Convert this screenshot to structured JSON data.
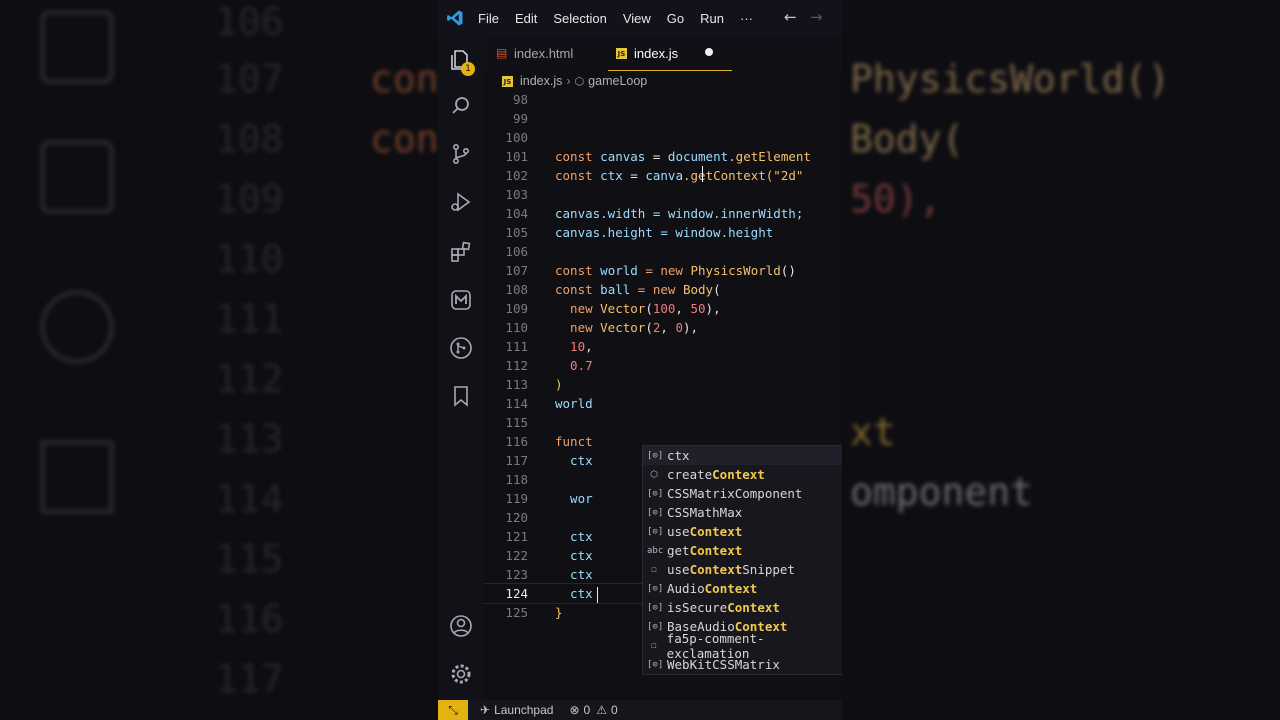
{
  "menubar": {
    "items": [
      "File",
      "Edit",
      "Selection",
      "View",
      "Go",
      "Run",
      "···"
    ]
  },
  "tabs": [
    {
      "label": "index.html",
      "type": "html"
    },
    {
      "label": "index.js",
      "type": "js",
      "modified": true
    }
  ],
  "breadcrumb": {
    "file": "index.js",
    "symbol": "gameLoop"
  },
  "activity_badge": "1",
  "editor": {
    "line_numbers": [
      "98",
      "99",
      "100",
      "101",
      "102",
      "103",
      "104",
      "105",
      "106",
      "107",
      "108",
      "109",
      "110",
      "111",
      "112",
      "113",
      "114",
      "115",
      "116",
      "117",
      "118",
      "119",
      "120",
      "121",
      "122",
      "123",
      "124",
      "125"
    ],
    "lines": {
      "l101": {
        "kw": "const",
        "a": " canvas ",
        "b": "= ",
        "c": "document",
        "d": ".getElement"
      },
      "l102": {
        "kw": "const",
        "a": " ctx ",
        "b": "= ",
        "c": "canva",
        "d": ".getContext(\"2d\""
      },
      "l104": "canvas.width = window.innerWidth;",
      "l105": "canvas.height = window.height",
      "l107": {
        "kw": "const",
        "a": " world ",
        "b": "= new ",
        "c": "PhysicsWorld",
        "d": "()"
      },
      "l108": {
        "kw": "const",
        "a": " ball ",
        "b": "= new ",
        "c": "Body",
        "d": "("
      },
      "l109": {
        "a": "  new ",
        "b": "Vector",
        "c": "(",
        "n1": "100",
        "d": ", ",
        "n2": "50",
        "e": "),"
      },
      "l110": {
        "a": "  new ",
        "b": "Vector",
        "c": "(",
        "n1": "2",
        "d": ", ",
        "n2": "0",
        "e": "),"
      },
      "l111": {
        "n": "  10",
        "e": ","
      },
      "l112": "  0.7",
      "l113": ")",
      "l114": "world",
      "l116": "funct",
      "l117": "  ctx",
      "l119": "  wor",
      "l121": "  ctx",
      "l122": "  ctx",
      "l123": "  ctx",
      "l124": "  ctx",
      "l125": "}"
    }
  },
  "suggestions": [
    {
      "icon": "variable-icon",
      "pre": "ctx",
      "hi": "",
      "post": ""
    },
    {
      "icon": "method-icon",
      "pre": "create",
      "hi": "Context",
      "post": ""
    },
    {
      "icon": "variable-icon",
      "pre": "CSSMatrixComponent",
      "hi": "",
      "post": ""
    },
    {
      "icon": "variable-icon",
      "pre": "CSSMathMax",
      "hi": "",
      "post": ""
    },
    {
      "icon": "variable-icon",
      "pre": "use",
      "hi": "Context",
      "post": ""
    },
    {
      "icon": "text-icon",
      "pre": "get",
      "hi": "Context",
      "post": ""
    },
    {
      "icon": "snippet-icon",
      "pre": "use",
      "hi": "Context",
      "post": "Snippet"
    },
    {
      "icon": "variable-icon",
      "pre": "Audio",
      "hi": "Context",
      "post": ""
    },
    {
      "icon": "variable-icon",
      "pre": "isSecure",
      "hi": "Context",
      "post": ""
    },
    {
      "icon": "variable-icon",
      "pre": "BaseAudio",
      "hi": "Context",
      "post": ""
    },
    {
      "icon": "snippet-icon",
      "pre": "fa5p-comment-exclamation",
      "hi": "",
      "post": ""
    },
    {
      "icon": "variable-icon",
      "pre": "WebKitCSSMatrix",
      "hi": "",
      "post": ""
    }
  ],
  "statusbar": {
    "launchpad": "Launchpad",
    "errors": "0",
    "warnings": "0"
  },
  "background": {
    "numbers": [
      "106",
      "107",
      "108",
      "109",
      "110",
      "111",
      "112",
      "113",
      "114",
      "115",
      "116",
      "117"
    ],
    "code_left": [
      "cons",
      "cons"
    ],
    "code_right": [
      "PhysicsWorld()",
      "Body(",
      "50),",
      "xt",
      "omponent"
    ]
  },
  "colors": {
    "accent": "#e5b213",
    "keyword": "#f0a06a",
    "number": "#f07c7c",
    "function": "#f5c06b"
  }
}
